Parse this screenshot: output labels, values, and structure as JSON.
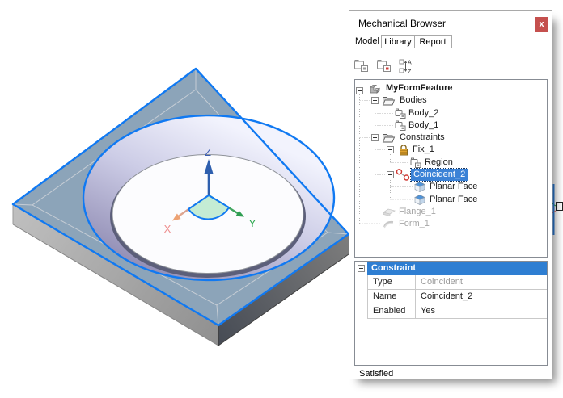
{
  "panel": {
    "title": "Mechanical Browser",
    "close_label": "x",
    "tabs": [
      "Model",
      "Library",
      "Report"
    ],
    "active_tab": "Model",
    "status": "Satisfied"
  },
  "toolbar": {
    "icons": [
      "group-bodies-icon",
      "group-bodies-highlight-icon",
      "sort-alphabetic-icon"
    ]
  },
  "tree": {
    "items": [
      {
        "label": "MyFormFeature",
        "icon": "form-feature-icon",
        "level": 0,
        "expanded": true,
        "bold": true
      },
      {
        "label": "Bodies",
        "icon": "folder-open-icon",
        "level": 1,
        "expanded": true
      },
      {
        "label": "Body_2",
        "icon": "body-icon",
        "level": 2
      },
      {
        "label": "Body_1",
        "icon": "body-icon",
        "level": 2
      },
      {
        "label": "Constraints",
        "icon": "folder-open-icon",
        "level": 1,
        "expanded": true
      },
      {
        "label": "Fix_1",
        "icon": "lock-icon",
        "level": 2,
        "expanded": true
      },
      {
        "label": "Region",
        "icon": "body-icon",
        "level": 3
      },
      {
        "label": "Coincident_2",
        "icon": "coincident-icon",
        "level": 2,
        "expanded": true,
        "selected": true
      },
      {
        "label": "Planar Face",
        "icon": "planar-face-icon",
        "level": 3
      },
      {
        "label": "Planar Face",
        "icon": "planar-face-icon",
        "level": 3
      },
      {
        "label": "Flange_1",
        "icon": "flange-icon",
        "level": 1,
        "disabled": true
      },
      {
        "label": "Form_1",
        "icon": "form-icon",
        "level": 1,
        "disabled": true
      }
    ]
  },
  "properties": {
    "header": "Constraint",
    "rows": [
      {
        "name": "Type",
        "value": "Coincident",
        "muted": true
      },
      {
        "name": "Name",
        "value": "Coincident_2"
      },
      {
        "name": "Enabled",
        "value": "Yes"
      }
    ]
  },
  "viewport": {
    "axis_labels": {
      "x": "X",
      "y": "Y",
      "z": "Z"
    },
    "sort_icon_letters": {
      "a": "A",
      "z": "Z"
    }
  },
  "colors": {
    "selection_blue": "#3b82d6",
    "property_header_blue": "#2e7ed2",
    "edge_highlight_blue": "#1079f2",
    "close_button_red": "#c5504e",
    "axis_x": "#ee8f8f",
    "axis_y": "#2aa64d",
    "axis_z": "#3a5db2",
    "top_face": "#8ca4b9"
  }
}
